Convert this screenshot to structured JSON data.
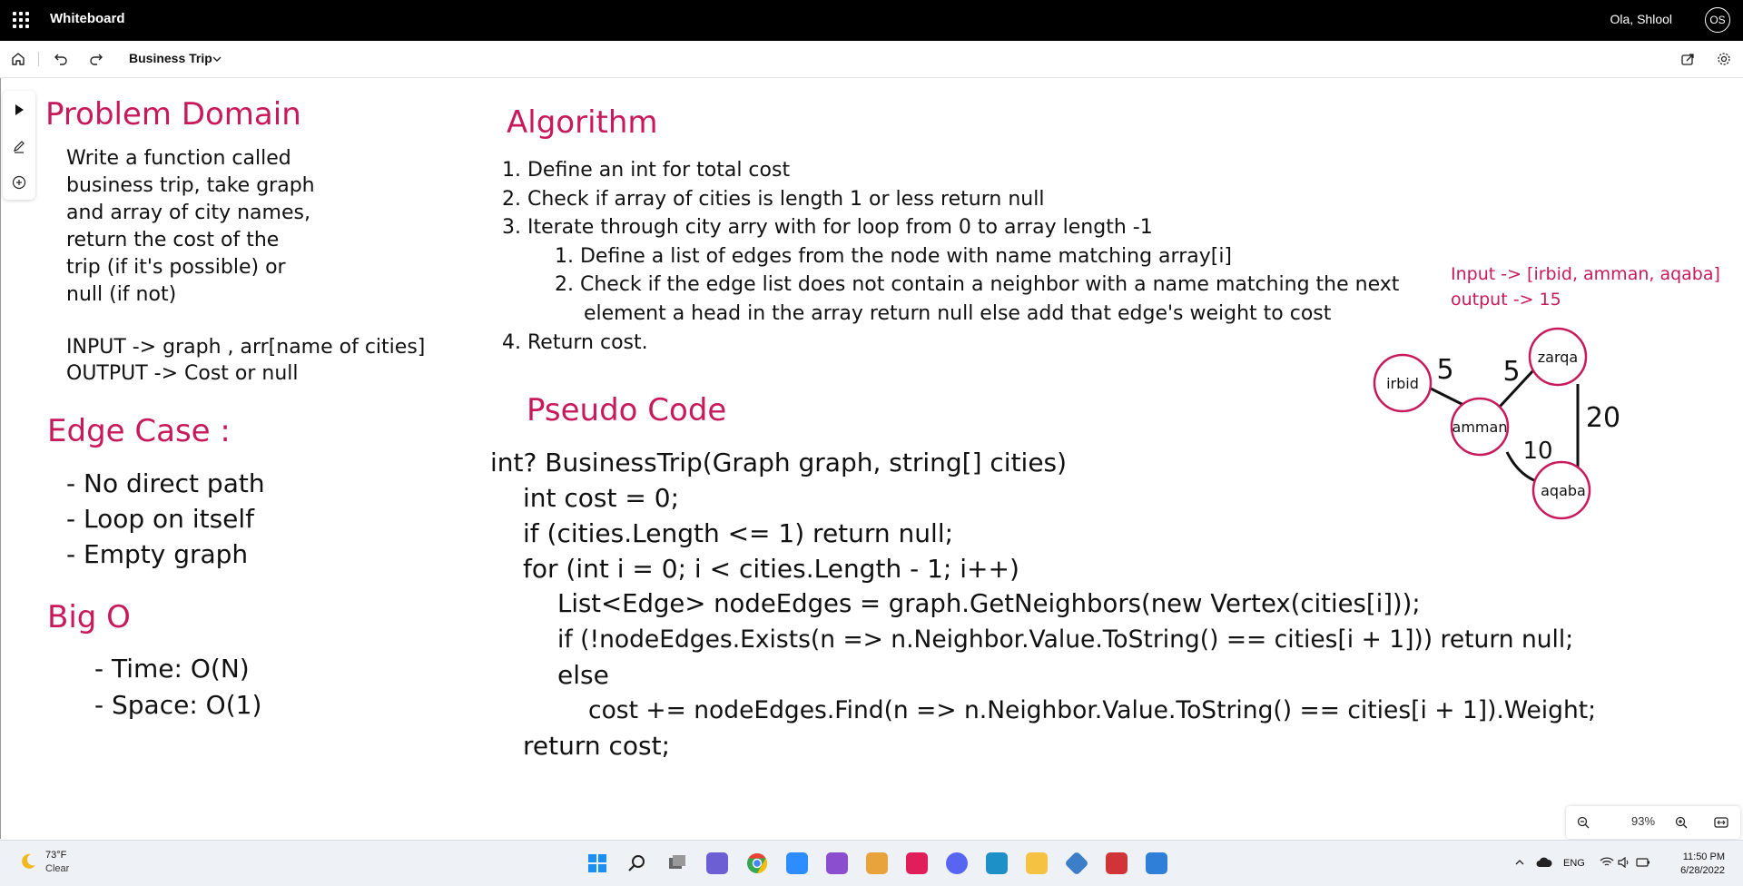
{
  "app": {
    "name": "Whiteboard",
    "user": "Ola, Shlool",
    "initials": "OS"
  },
  "toolbar": {
    "doc_title": "Business Trip"
  },
  "problem": {
    "heading": "Problem Domain",
    "lines": [
      "Write a function called",
      "business trip, take graph",
      "and array of city names,",
      "return the cost of the",
      "trip (if it's possible) or",
      "null (if not)"
    ],
    "io": [
      "INPUT -> graph , arr[name of cities]",
      "OUTPUT -> Cost or null"
    ]
  },
  "edge": {
    "heading": "Edge Case :",
    "items": [
      "- No direct path",
      "- Loop on itself",
      "- Empty graph"
    ]
  },
  "bigo": {
    "heading": "Big O",
    "items": [
      "- Time: O(N)",
      "- Space: O(1)"
    ]
  },
  "algorithm": {
    "heading": "Algorithm",
    "steps": [
      "1. Define an int for total cost",
      "2. Check if array of cities is length 1 or less return null",
      "3. Iterate through city arry with for loop from 0 to array length -1",
      "1. Define a list of edges from the node with name matching array[i]",
      "2. Check if the edge list does not contain a neighbor with a name matching the next",
      "element a head in the array return null else add that edge's weight to cost",
      "4. Return cost."
    ]
  },
  "pseudo": {
    "heading": "Pseudo Code",
    "lines": [
      "int? BusinessTrip(Graph graph, string[] cities)",
      "int cost = 0;",
      "if (cities.Length <= 1) return null;",
      "for (int i = 0; i < cities.Length - 1; i++)",
      "List<Edge> nodeEdges = graph.GetNeighbors(new Vertex(cities[i]));",
      "if (!nodeEdges.Exists(n => n.Neighbor.Value.ToString() == cities[i + 1])) return null;",
      "else",
      "cost += nodeEdges.Find(n => n.Neighbor.Value.ToString() == cities[i + 1]).Weight;",
      "return cost;"
    ]
  },
  "example": {
    "input": "Input -> [irbid, amman, aqaba]",
    "output": "output -> 15"
  },
  "graph": {
    "nodes": [
      "irbid",
      "amman",
      "zarqa",
      "aqaba"
    ],
    "weights": [
      "5",
      "5",
      "10",
      "20"
    ],
    "stroke": "#c8195c"
  },
  "zoom": {
    "level": "93%"
  },
  "weather": {
    "temp": "73°F",
    "cond": "Clear"
  },
  "tray": {
    "lang": "ENG",
    "time": "11:50 PM",
    "date": "6/28/2022"
  },
  "colors": {
    "accent": "#c8195c",
    "titlebar": "#000000"
  }
}
